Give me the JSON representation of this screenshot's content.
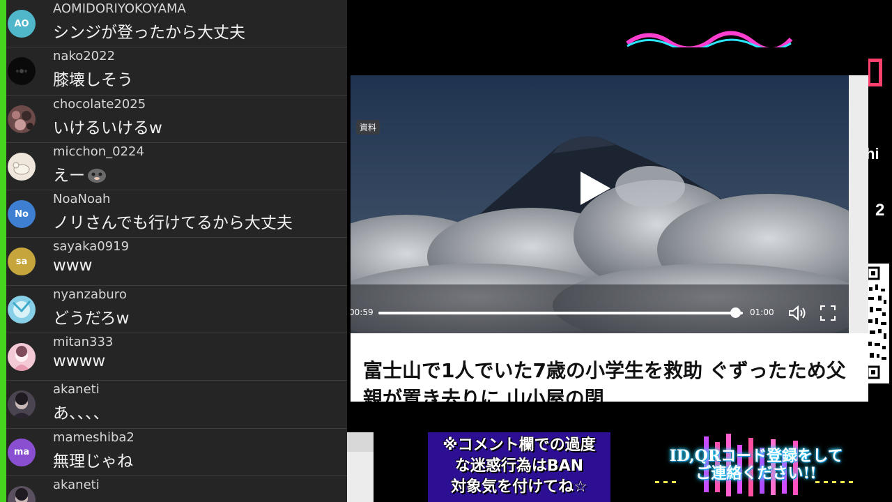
{
  "chat": {
    "messages": [
      {
        "avatar_text": "AO",
        "avatar_color": "#4fb7c9",
        "username": "AOMIDORIYOKOYAMA",
        "text": "シンジが登ったから大丈夫"
      },
      {
        "avatar_text": "",
        "avatar_color": "#0a0a0a",
        "username": "nako2022",
        "text": "膝壊しそう"
      },
      {
        "avatar_text": "",
        "avatar_color": "#6d4a4a",
        "username": "chocolate2025",
        "text": "いけるいけるw"
      },
      {
        "avatar_text": "",
        "avatar_color": "#efe6dc",
        "username": "micchon_0224",
        "text": "えー"
      },
      {
        "avatar_text": "No",
        "avatar_color": "#3e7fd1",
        "username": "NoaNoah",
        "text": "ノリさんでも行けてるから大丈夫"
      },
      {
        "avatar_text": "sa",
        "avatar_color": "#c6a63c",
        "username": "sayaka0919",
        "text": "www"
      },
      {
        "avatar_text": "",
        "avatar_color": "#86cfe6",
        "username": "nyanzaburo",
        "text": "どうだろw"
      },
      {
        "avatar_text": "",
        "avatar_color": "#f2c9d4",
        "username": "mitan333",
        "text": "wwww"
      },
      {
        "avatar_text": "",
        "avatar_color": "#4a4450",
        "username": "akaneti",
        "text": "あ、、、、"
      },
      {
        "avatar_text": "ma",
        "avatar_color": "#8a4fd0",
        "username": "mameshiba2",
        "text": "無理じゃね"
      },
      {
        "avatar_text": "",
        "avatar_color": "#5a5060",
        "username": "akaneti",
        "text": ""
      }
    ]
  },
  "video": {
    "tag": "資料",
    "current_time": "00:59",
    "duration": "01:00",
    "progress": 0.98
  },
  "article": {
    "headline": "富士山で1人でいた7歳の小学生を救助 ぐずったため父親が置き去りに 山小屋の閉"
  },
  "side": {
    "text_hi": "hi",
    "text_2": "2"
  },
  "banners": {
    "notice": "※コメント欄での過度\nな迷惑行為はBAN\n対象気を付けてね☆",
    "register": "ID,QRコード登録をして\nご連絡ください!!"
  },
  "colors": {
    "chat_bg": "#252525",
    "accent_green": "#46d41c",
    "notice_bg": "#2c0f93",
    "glow_cyan": "#2fd5ff"
  }
}
